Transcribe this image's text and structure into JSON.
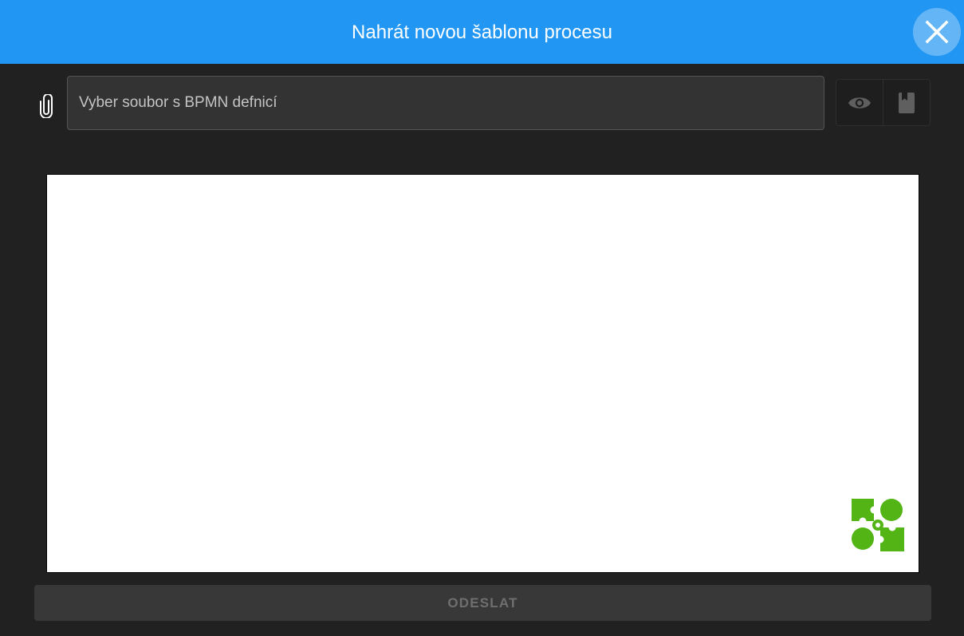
{
  "dialog": {
    "title": "Nahrát novou šablonu procesu",
    "close_icon": "close-icon"
  },
  "file_picker": {
    "icon": "paperclip-icon",
    "placeholder": "Vyber soubor s BPMN defnicí",
    "value": ""
  },
  "toolbar": {
    "preview_icon": "eye-icon",
    "library_icon": "book-icon"
  },
  "preview": {
    "logo_icon": "puzzle-gears-logo"
  },
  "submit": {
    "label": "ODESLAT",
    "disabled": true
  },
  "colors": {
    "header": "#2196f3",
    "close_button": "#64b5f6",
    "background": "#212121",
    "logo": "#52b415"
  }
}
